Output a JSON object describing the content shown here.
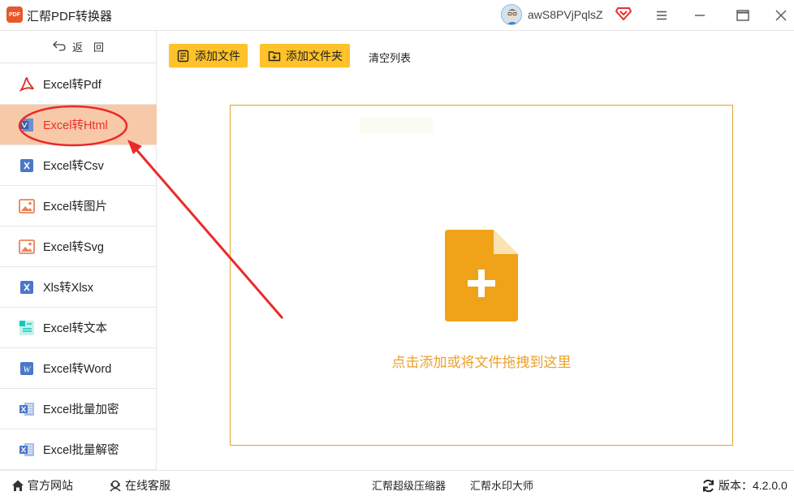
{
  "window": {
    "title": "汇帮PDF转换器",
    "logo_text": "PDF",
    "username": "awS8PVjPqlsZ"
  },
  "sidebar": {
    "back_label": "返　回",
    "items": [
      {
        "label": "Excel转Pdf",
        "icon": "pdf-icon"
      },
      {
        "label": "Excel转Html",
        "icon": "html-icon",
        "active": true
      },
      {
        "label": "Excel转Csv",
        "icon": "csv-icon"
      },
      {
        "label": "Excel转图片",
        "icon": "image-icon"
      },
      {
        "label": "Excel转Svg",
        "icon": "svg-image-icon"
      },
      {
        "label": "Xls转Xlsx",
        "icon": "xlsx-icon"
      },
      {
        "label": "Excel转文本",
        "icon": "text-icon"
      },
      {
        "label": "Excel转Word",
        "icon": "word-icon"
      },
      {
        "label": "Excel批量加密",
        "icon": "excel-lock-icon"
      },
      {
        "label": "Excel批量解密",
        "icon": "excel-unlock-icon"
      }
    ]
  },
  "toolbar": {
    "add_file": "添加文件",
    "add_folder": "添加文件夹",
    "clear_list": "清空列表"
  },
  "dropzone": {
    "text": "点击添加或将文件拖拽到这里"
  },
  "statusbar": {
    "website": "官方网站",
    "support": "在线客服",
    "compressor": "汇帮超级压缩器",
    "watermark": "汇帮水印大师",
    "version_label": "版本：",
    "version": "4.2.0.0"
  },
  "colors": {
    "accent": "#ffc22a",
    "active_bg": "#f8c9a8",
    "active_text": "#e8302c",
    "annotation": "#ea2a2a",
    "drop_border": "#e0a52a",
    "drop_icon": "#f0a318"
  }
}
